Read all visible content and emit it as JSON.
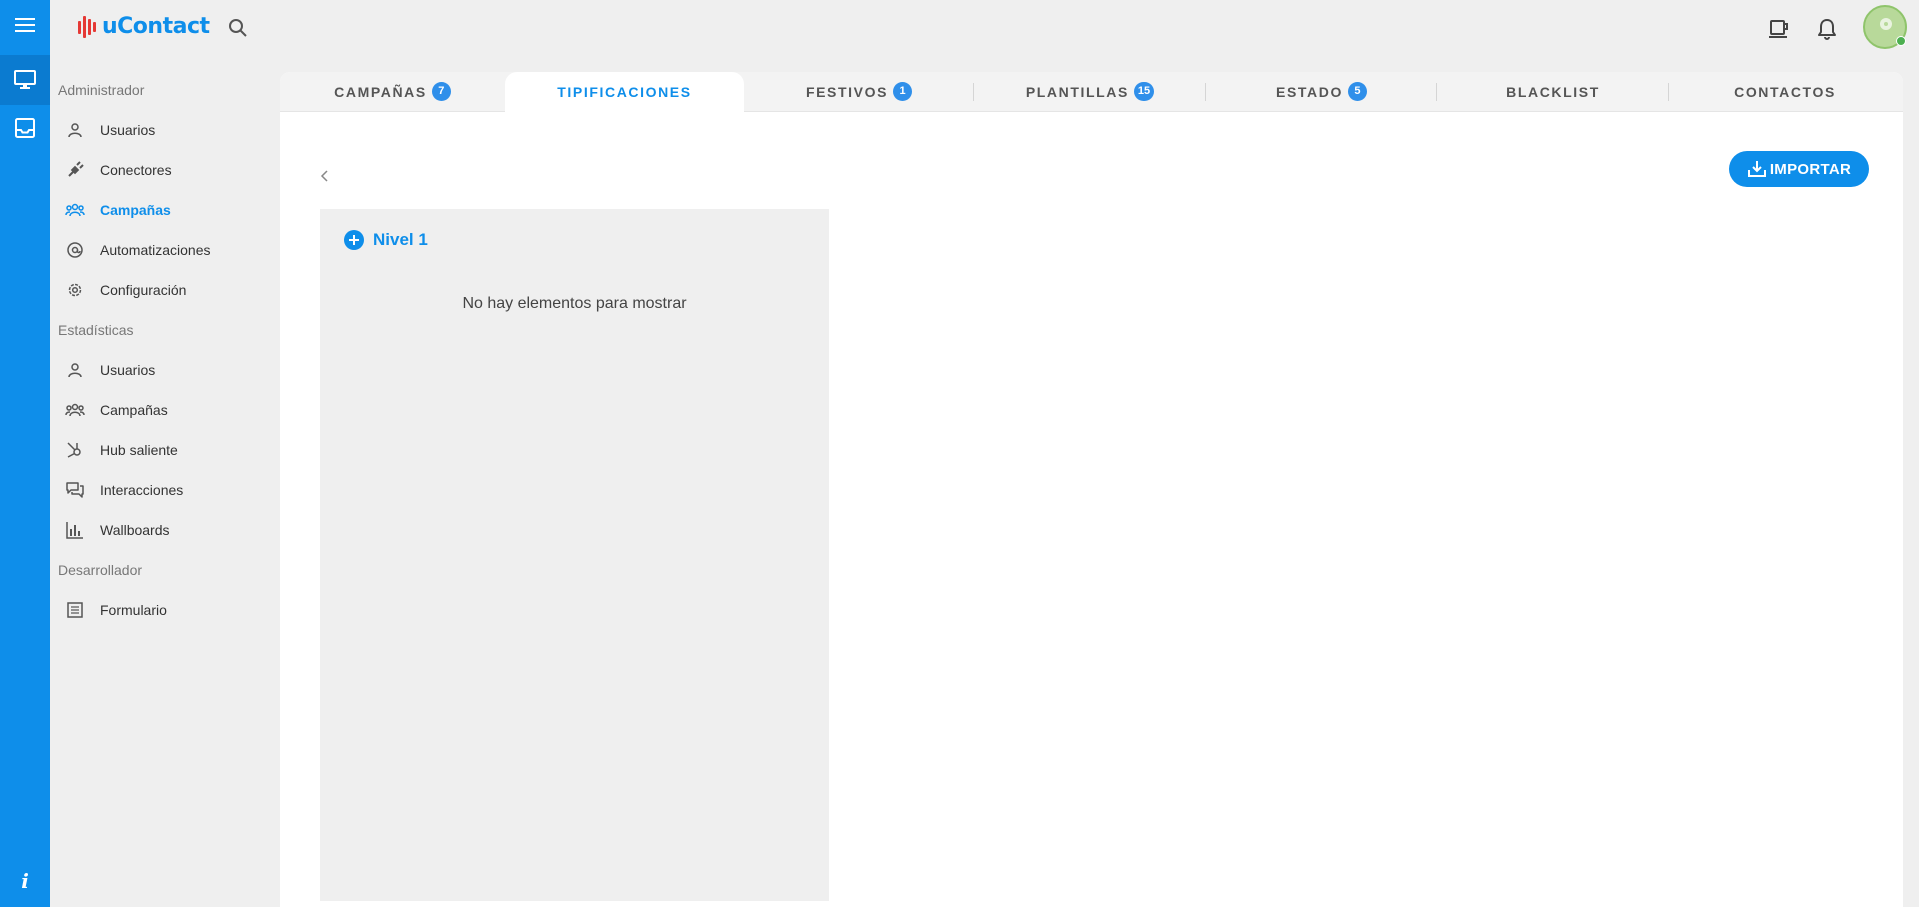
{
  "app": {
    "logo_text": "uContact"
  },
  "header": {
    "icons": [
      "search-icon",
      "break-cup-icon",
      "bell-icon",
      "avatar"
    ]
  },
  "sidebar": {
    "sections": [
      {
        "title": "Administrador",
        "items": [
          {
            "label": "Usuarios",
            "icon": "user-icon"
          },
          {
            "label": "Conectores",
            "icon": "plug-icon"
          },
          {
            "label": "Campañas",
            "icon": "group-icon",
            "active": true
          },
          {
            "label": "Automatizaciones",
            "icon": "at-gear-icon"
          },
          {
            "label": "Configuración",
            "icon": "gear-icon"
          }
        ]
      },
      {
        "title": "Estadísticas",
        "items": [
          {
            "label": "Usuarios",
            "icon": "user-icon"
          },
          {
            "label": "Campañas",
            "icon": "group-icon"
          },
          {
            "label": "Hub saliente",
            "icon": "hub-icon"
          },
          {
            "label": "Interacciones",
            "icon": "chat-icon"
          },
          {
            "label": "Wallboards",
            "icon": "bar-chart-icon"
          }
        ]
      },
      {
        "title": "Desarrollador",
        "items": [
          {
            "label": "Formulario",
            "icon": "form-icon"
          }
        ]
      }
    ]
  },
  "tabs": [
    {
      "label": "CAMPAÑAS",
      "badge": "7"
    },
    {
      "label": "TIPIFICACIONES",
      "badge": "",
      "active": true
    },
    {
      "label": "FESTIVOS",
      "badge": "1"
    },
    {
      "label": "PLANTILLAS",
      "badge": "15"
    },
    {
      "label": "ESTADO",
      "badge": "5"
    },
    {
      "label": "BLACKLIST",
      "badge": ""
    },
    {
      "label": "CONTACTOS",
      "badge": ""
    }
  ],
  "main": {
    "import_label": "IMPORTAR",
    "level_title": "Nivel 1",
    "empty_message": "No hay elementos para mostrar"
  },
  "rail": {
    "info_label": "i"
  },
  "colors": {
    "accent": "#0e8eea",
    "badge": "#2f8fea",
    "background": "#efefef"
  }
}
